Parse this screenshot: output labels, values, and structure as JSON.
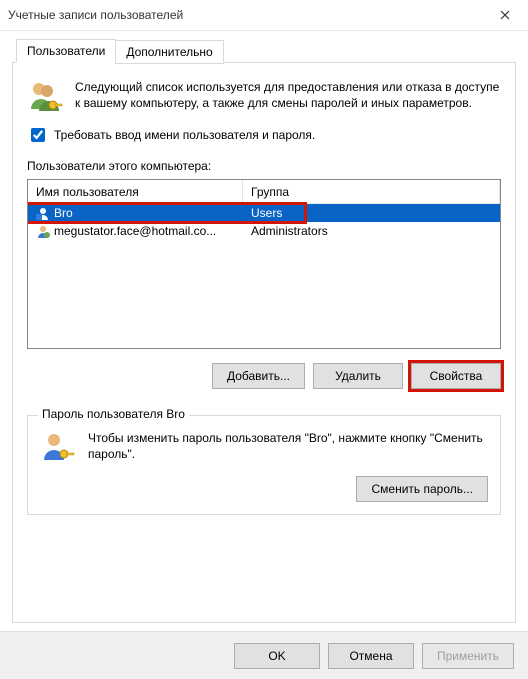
{
  "window": {
    "title": "Учетные записи пользователей"
  },
  "tabs": {
    "active": "Пользователи",
    "inactive": "Дополнительно"
  },
  "intro": "Следующий список используется для предоставления или отказа в доступе к вашему компьютеру, а также для смены паролей и иных параметров.",
  "require_login_label": "Требовать ввод имени пользователя и пароля.",
  "users_label": "Пользователи этого компьютера:",
  "columns": {
    "name": "Имя пользователя",
    "group": "Группа"
  },
  "rows": [
    {
      "name": "Bro",
      "group": "Users",
      "selected": true
    },
    {
      "name": "megustator.face@hotmail.co...",
      "group": "Administrators",
      "selected": false
    }
  ],
  "buttons": {
    "add": "Добавить...",
    "remove": "Удалить",
    "props": "Свойства"
  },
  "password_group": {
    "legend": "Пароль пользователя Bro",
    "text": "Чтобы изменить пароль пользователя \"Bro\", нажмите кнопку \"Сменить пароль\".",
    "change": "Сменить пароль..."
  },
  "footer": {
    "ok": "OK",
    "cancel": "Отмена",
    "apply": "Применить"
  }
}
